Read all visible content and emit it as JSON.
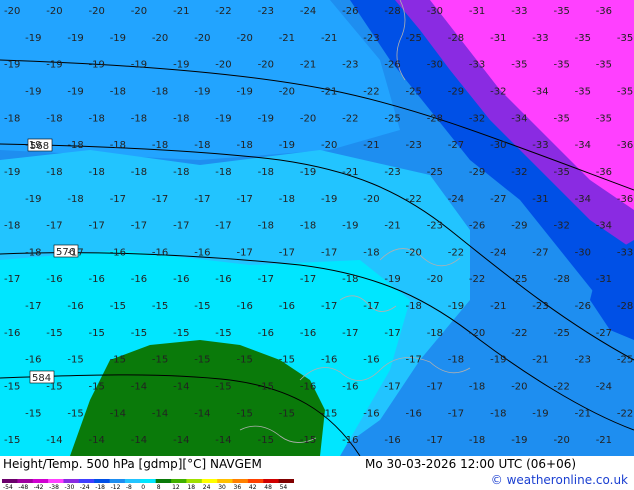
{
  "map": {
    "title": "Height/Temp. 500 hPa [gdmp][°C] NAVGEM",
    "datetime": "Mo 30-03-2026 12:00 UTC (06+06)",
    "credit": "© weatheronline.co.uk",
    "contours": [
      "568",
      "576",
      "584"
    ],
    "legend_ticks": [
      "-54",
      "-48",
      "-42",
      "-38",
      "-30",
      "-24",
      "-18",
      "-12",
      "-8",
      "0",
      "8",
      "12",
      "18",
      "24",
      "30",
      "36",
      "42",
      "48",
      "54"
    ],
    "colors": {
      "warm_green": "#0a7a0a",
      "light_cyan": "#00e6ff",
      "sky": "#22b8ff",
      "blue": "#1e8ef0",
      "deep_blue": "#0050e6",
      "violet": "#8a2be2",
      "magenta": "#ff40ff",
      "credit_blue": "#1a3fd1"
    },
    "temp_labels": [
      [
        "-20",
        "-20",
        "-20",
        "-20",
        "-21",
        "-22",
        "-23",
        "-24",
        "-26",
        "-28",
        "-30",
        "-31",
        "-33",
        "-35",
        "-36"
      ],
      [
        "-19",
        "-19",
        "-19",
        "-20",
        "-20",
        "-20",
        "-21",
        "-21",
        "-23",
        "-25",
        "-28",
        "-31",
        "-33",
        "-35",
        "-35"
      ],
      [
        "-19",
        "-19",
        "-19",
        "-19",
        "-19",
        "-20",
        "-20",
        "-21",
        "-23",
        "-26",
        "-30",
        "-33",
        "-35",
        "-35",
        "-35"
      ],
      [
        "-19",
        "-19",
        "-18",
        "-18",
        "-19",
        "-19",
        "-20",
        "-21",
        "-22",
        "-25",
        "-29",
        "-32",
        "-34",
        "-35",
        "-35"
      ],
      [
        "-18",
        "-18",
        "-18",
        "-18",
        "-18",
        "-19",
        "-19",
        "-20",
        "-22",
        "-25",
        "-28",
        "-32",
        "-34",
        "-35",
        "-35"
      ],
      [
        "-19",
        "-18",
        "-18",
        "-18",
        "-18",
        "-18",
        "-19",
        "-20",
        "-21",
        "-23",
        "-27",
        "-30",
        "-33",
        "-34",
        "-36"
      ],
      [
        "-19",
        "-18",
        "-18",
        "-18",
        "-18",
        "-18",
        "-18",
        "-19",
        "-21",
        "-23",
        "-25",
        "-29",
        "-32",
        "-35",
        "-36"
      ],
      [
        "-19",
        "-18",
        "-17",
        "-17",
        "-17",
        "-17",
        "-18",
        "-19",
        "-20",
        "-22",
        "-24",
        "-27",
        "-31",
        "-34",
        "-36"
      ],
      [
        "-18",
        "-17",
        "-17",
        "-17",
        "-17",
        "-17",
        "-18",
        "-18",
        "-19",
        "-21",
        "-23",
        "-26",
        "-29",
        "-32",
        "-34"
      ],
      [
        "-18",
        "-17",
        "-16",
        "-16",
        "-16",
        "-17",
        "-17",
        "-17",
        "-18",
        "-20",
        "-22",
        "-24",
        "-27",
        "-30",
        "-33"
      ],
      [
        "-17",
        "-16",
        "-16",
        "-16",
        "-16",
        "-16",
        "-17",
        "-17",
        "-18",
        "-19",
        "-20",
        "-22",
        "-25",
        "-28",
        "-31"
      ],
      [
        "-17",
        "-16",
        "-15",
        "-15",
        "-15",
        "-16",
        "-16",
        "-17",
        "-17",
        "-18",
        "-19",
        "-21",
        "-23",
        "-26",
        "-28"
      ],
      [
        "-16",
        "-15",
        "-15",
        "-15",
        "-15",
        "-15",
        "-16",
        "-16",
        "-17",
        "-17",
        "-18",
        "-20",
        "-22",
        "-25",
        "-27"
      ],
      [
        "-16",
        "-15",
        "-15",
        "-15",
        "-15",
        "-15",
        "-15",
        "-16",
        "-16",
        "-17",
        "-18",
        "-19",
        "-21",
        "-23",
        "-25"
      ],
      [
        "-15",
        "-15",
        "-15",
        "-14",
        "-14",
        "-15",
        "-15",
        "-16",
        "-16",
        "-17",
        "-17",
        "-18",
        "-20",
        "-22",
        "-24"
      ],
      [
        "-15",
        "-15",
        "-14",
        "-14",
        "-14",
        "-15",
        "-15",
        "-15",
        "-16",
        "-16",
        "-17",
        "-18",
        "-19",
        "-21",
        "-22"
      ],
      [
        "-15",
        "-14",
        "-14",
        "-14",
        "-14",
        "-14",
        "-15",
        "-15",
        "-16",
        "-16",
        "-17",
        "-18",
        "-19",
        "-20",
        "-21"
      ]
    ]
  }
}
